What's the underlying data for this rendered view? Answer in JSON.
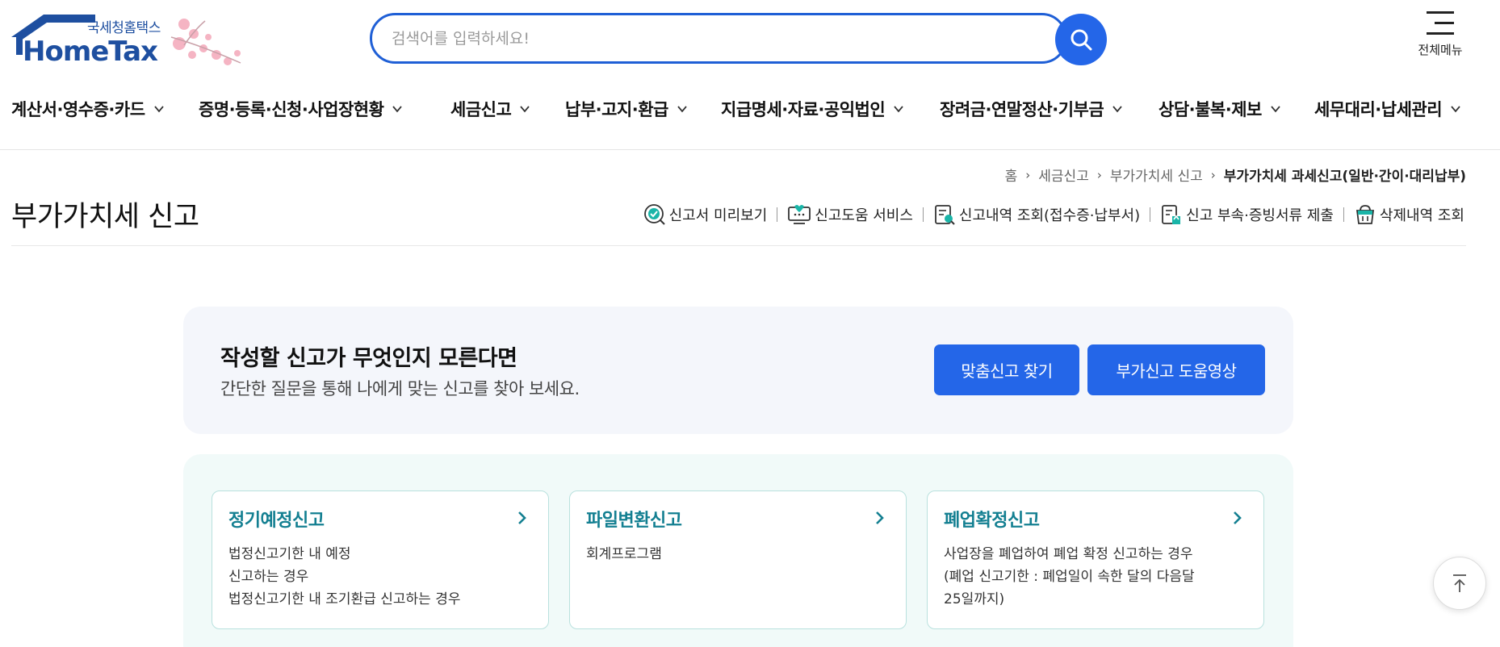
{
  "logo": {
    "sub_text": "국세청홈택스",
    "main_text": "HomeTax",
    "brand_color": "#1e4fa0"
  },
  "search": {
    "placeholder": "검색어를 입력하세요!",
    "value": "",
    "icon": "search-icon"
  },
  "all_menu": {
    "label": "전체메뉴",
    "icon": "hamburger-icon"
  },
  "gnb": {
    "items": [
      {
        "label": "계산서·영수증·카드"
      },
      {
        "label": "증명·등록·신청·사업장현황"
      },
      {
        "label": "세금신고"
      },
      {
        "label": "납부·고지·환급"
      },
      {
        "label": "지급명세·자료·공익법인"
      },
      {
        "label": "장려금·연말정산·기부금"
      },
      {
        "label": "상담·불복·제보"
      },
      {
        "label": "세무대리·납세관리"
      }
    ]
  },
  "breadcrumb": {
    "items": [
      "홈",
      "세금신고",
      "부가가치세 신고"
    ],
    "current": "부가가치세 과세신고(일반·간이·대리납부)"
  },
  "page": {
    "title": "부가가치세 신고"
  },
  "utility": {
    "items": [
      {
        "label": "신고서 미리보기",
        "icon": "check-circle-icon"
      },
      {
        "label": "신고도움 서비스",
        "icon": "monitor-help-icon"
      },
      {
        "label": "신고내역 조회(접수증·납부서)",
        "icon": "document-search-icon"
      },
      {
        "label": "신고 부속·증빙서류 제출",
        "icon": "document-upload-icon"
      },
      {
        "label": "삭제내역 조회",
        "icon": "trash-basket-icon"
      }
    ]
  },
  "guide": {
    "title": "작성할 신고가 무엇인지 모른다면",
    "description": "간단한 질문을 통해 나에게 맞는 신고를 찾아 보세요.",
    "buttons": [
      {
        "label": "맞춤신고 찾기"
      },
      {
        "label": "부가신고 도움영상"
      }
    ]
  },
  "cards": [
    {
      "title": "정기예정신고",
      "description": "법정신고기한 내 예정\n신고하는 경우\n법정신고기한 내 조기환급 신고하는 경우"
    },
    {
      "title": "파일변환신고",
      "description": "회계프로그램"
    },
    {
      "title": "폐업확정신고",
      "description": "사업장을 폐업하여 폐업 확정 신고하는 경우\n(폐업 신고기한 : 폐업일이 속한 달의 다음달\n25일까지)"
    }
  ],
  "colors": {
    "primary_blue": "#2466e8",
    "card_title_teal": "#137f91",
    "guide_bg": "#f4f6fb",
    "cards_bg": "#f1faf9"
  },
  "top_button": {
    "icon": "arrow-up-icon"
  }
}
